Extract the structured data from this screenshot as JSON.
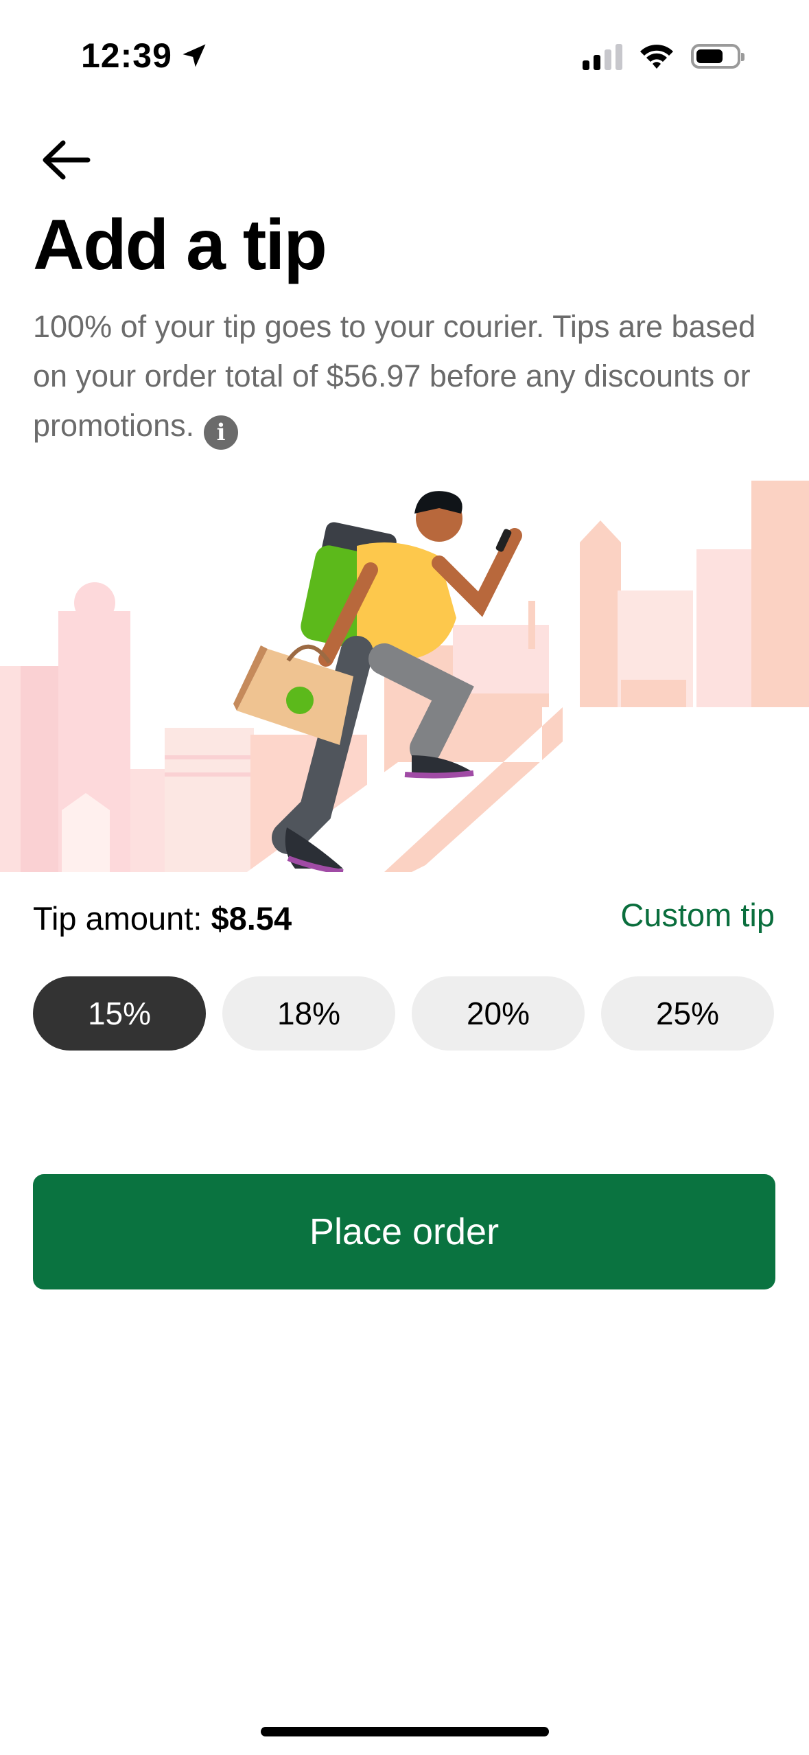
{
  "status_bar": {
    "time": "12:39"
  },
  "page": {
    "title": "Add a tip",
    "description": "100% of your tip goes to your courier. Tips are based on your order total of $56.97 before any discounts or promotions."
  },
  "tip": {
    "amount_label": "Tip amount: ",
    "amount_value": "$8.54",
    "custom_tip_label": "Custom tip",
    "options": [
      "15%",
      "18%",
      "20%",
      "25%"
    ],
    "selected": "15%"
  },
  "actions": {
    "place_order_label": "Place order"
  },
  "colors": {
    "accent_green": "#0a7340",
    "selected_chip": "#333333",
    "chip": "#eeeeee",
    "muted_text": "#6b6b6b"
  },
  "icons": [
    "location-arrow-icon",
    "signal-icon",
    "wifi-icon",
    "battery-icon",
    "back-arrow-icon",
    "info-icon"
  ]
}
